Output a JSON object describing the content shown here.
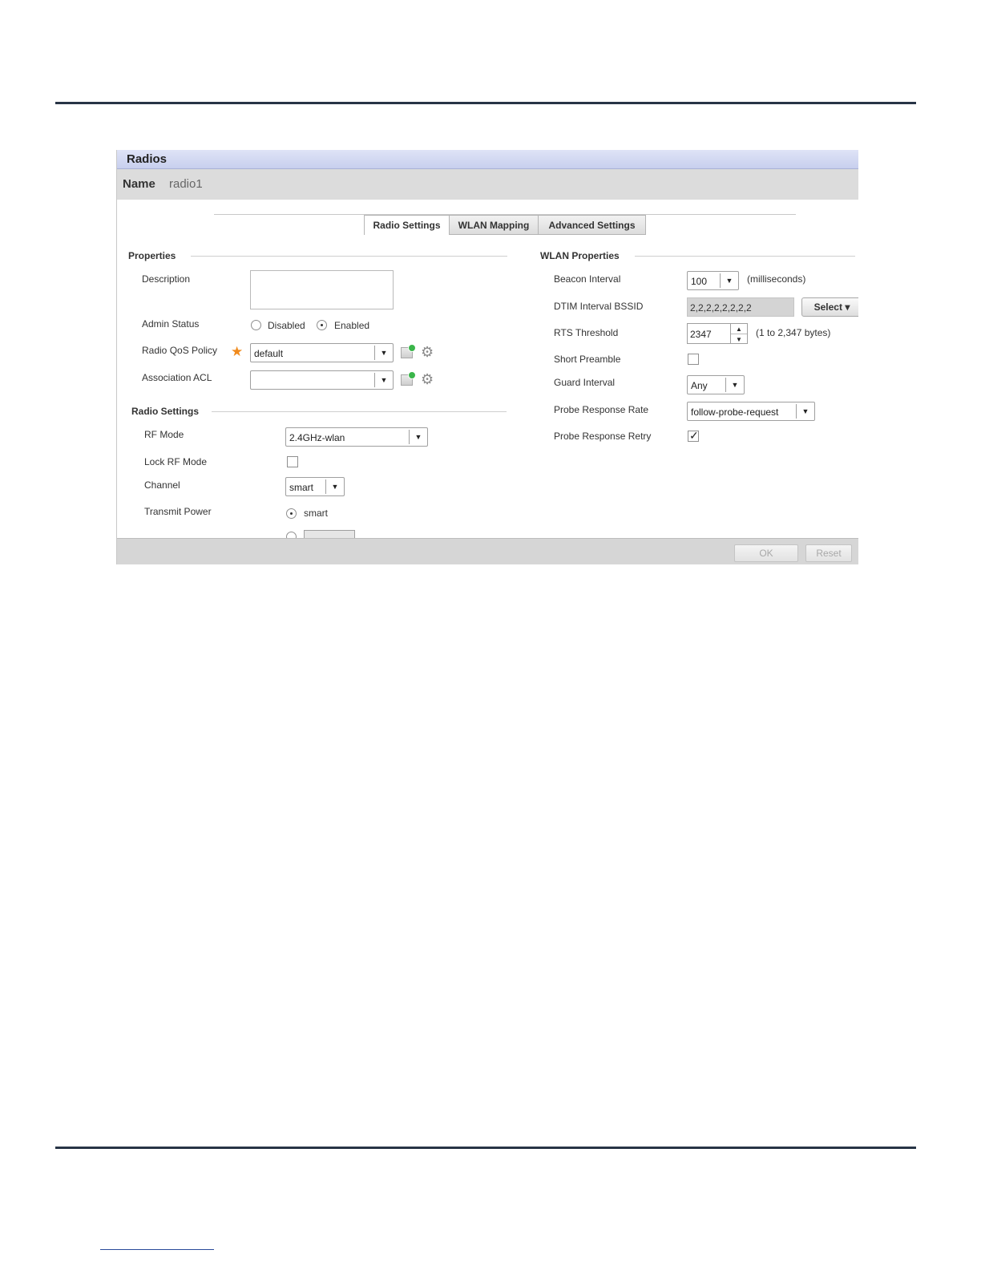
{
  "window": {
    "title": "Radios",
    "name_label": "Name",
    "name_value": "radio1"
  },
  "tabs": [
    {
      "label": "Radio Settings",
      "active": true
    },
    {
      "label": "WLAN Mapping",
      "active": false
    },
    {
      "label": "Advanced Settings",
      "active": false
    }
  ],
  "properties": {
    "section_title": "Properties",
    "description_label": "Description",
    "description_value": "",
    "admin_status_label": "Admin Status",
    "admin_status_options": [
      "Disabled",
      "Enabled"
    ],
    "admin_status_selected": "Enabled",
    "qos_label": "Radio QoS Policy",
    "qos_value": "default",
    "acl_label": "Association ACL",
    "acl_value": ""
  },
  "radio_settings": {
    "section_title": "Radio Settings",
    "rf_mode_label": "RF Mode",
    "rf_mode_value": "2.4GHz-wlan",
    "lock_rf_label": "Lock RF Mode",
    "lock_rf_checked": false,
    "channel_label": "Channel",
    "channel_value": "smart",
    "tx_power_label": "Transmit Power",
    "tx_power_option": "smart"
  },
  "wlan_properties": {
    "section_title": "WLAN Properties",
    "beacon_label": "Beacon Interval",
    "beacon_value": "100",
    "beacon_unit": "(milliseconds)",
    "dtim_label": "DTIM Interval BSSID",
    "dtim_value": "2,2,2,2,2,2,2,2",
    "dtim_button": "Select",
    "rts_label": "RTS Threshold",
    "rts_value": "2347",
    "rts_range": "(1 to 2,347 bytes)",
    "short_preamble_label": "Short Preamble",
    "short_preamble_checked": false,
    "guard_label": "Guard Interval",
    "guard_value": "Any",
    "probe_rate_label": "Probe Response Rate",
    "probe_rate_value": "follow-probe-request",
    "probe_retry_label": "Probe Response Retry",
    "probe_retry_checked": true
  },
  "footer": {
    "ok_label": "OK",
    "reset_label": "Reset"
  },
  "icons": {
    "arrow_down": "▼",
    "arrow_up": "▲",
    "star": "★",
    "gear": "⚙",
    "check": "✓",
    "caret": "▾"
  }
}
